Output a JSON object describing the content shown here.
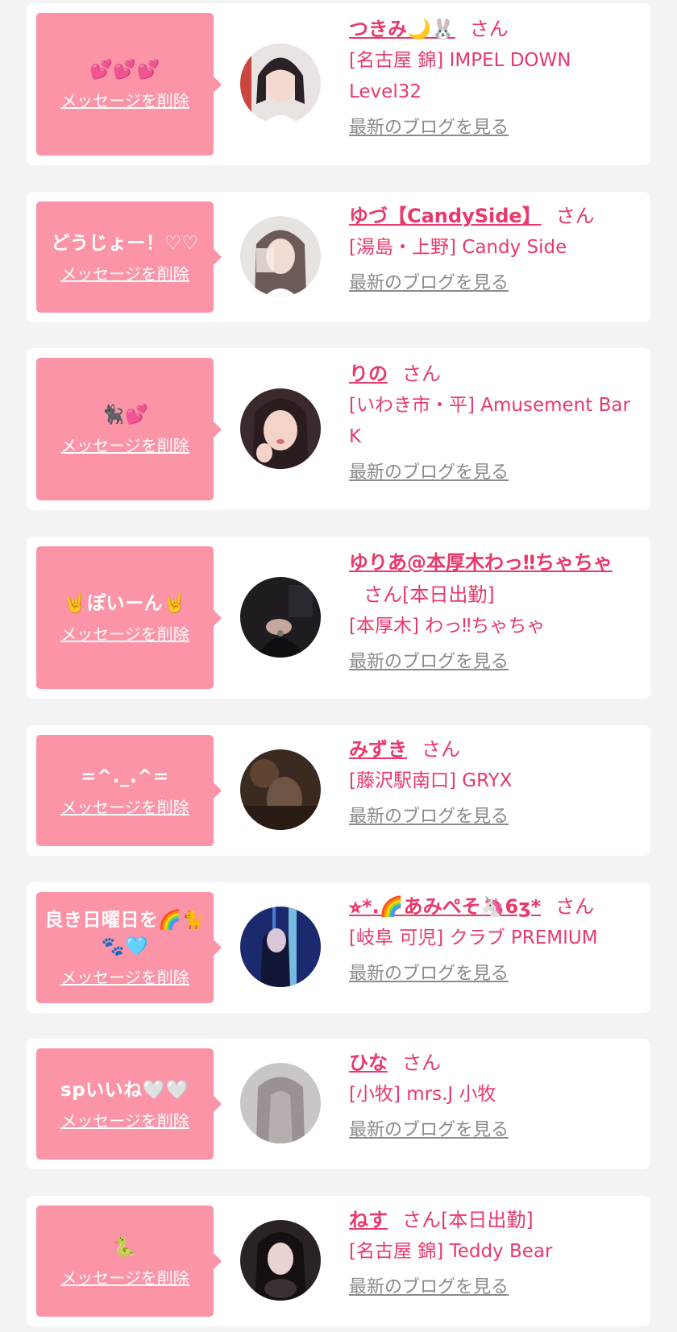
{
  "common": {
    "delete_label": "メッセージを削除",
    "blog_label": "最新のブログを見る",
    "san": "さん"
  },
  "colors": {
    "page_bg": "#f3f3f3",
    "bubble": "#fb94a7",
    "accent": "#e8396a",
    "link_gray": "#8a8a8a"
  },
  "messages": [
    {
      "message": "💕💕💕",
      "name": "つきみ🌙🐰",
      "san_suffix": "さん",
      "shop": "[名古屋 錦] IMPEL DOWN Level32"
    },
    {
      "message": "どうじょー！♡♡",
      "name": "ゆづ【CandySide】",
      "san_suffix": "さん",
      "shop": "[湯島・上野] Candy Side"
    },
    {
      "message": "🐈‍⬛💕",
      "name": "りの",
      "san_suffix": "さん",
      "shop": "[いわき市・平] Amusement Bar K"
    },
    {
      "message": "🤘ぽいーん🤘",
      "name": "ゆりあ@本厚木わっ‼ちゃちゃ",
      "san_suffix": "さん[本日出勤]",
      "shop": "[本厚木] わっ‼ちゃちゃ"
    },
    {
      "message": "=^._.^=",
      "name": "みずき",
      "san_suffix": "さん",
      "shop": "[藤沢駅南口] GRYX"
    },
    {
      "message": "良き日曜日を🌈🐈🐾🩵",
      "name": "⭐︎*.🌈あみぺそ🦄6ʒ*",
      "san_suffix": "さん",
      "shop": "[岐阜 可児] クラブ PREMIUM"
    },
    {
      "message": "spいいね🤍🤍",
      "name": "ひな",
      "san_suffix": "さん",
      "shop": "[小牧] mrs.J 小牧"
    },
    {
      "message": "🐍",
      "name": "ねす",
      "san_suffix": "さん[本日出勤]",
      "shop": "[名古屋 錦] Teddy Bear"
    }
  ]
}
